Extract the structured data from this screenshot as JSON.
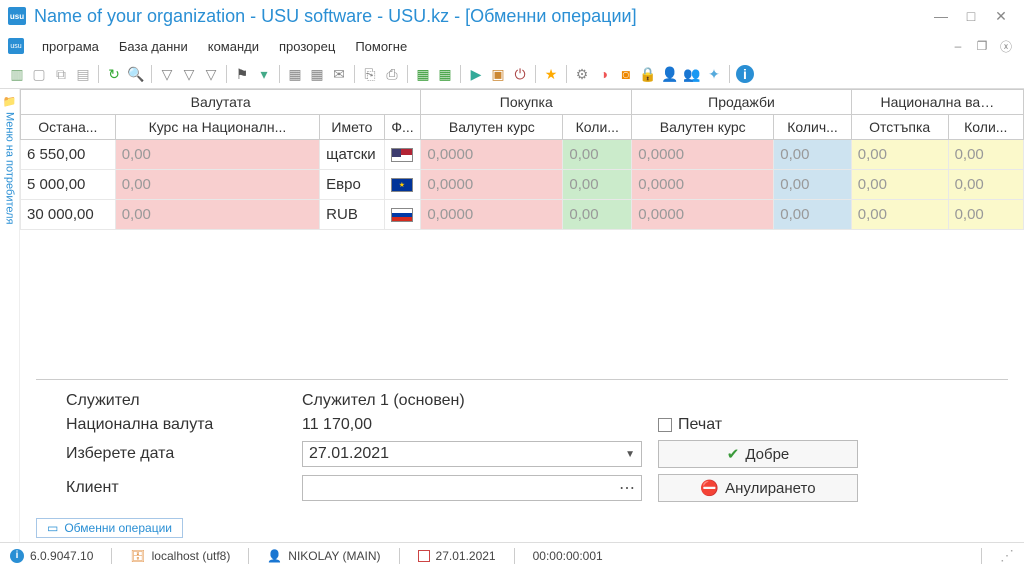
{
  "window": {
    "title": "Name of your organization - USU software - USU.kz - [Обменни операции]",
    "app_icon": "usu"
  },
  "menu": {
    "items": [
      "програма",
      "База данни",
      "команди",
      "прозорец",
      "Помогне"
    ]
  },
  "sidetab": {
    "label": "Меню на потребителя"
  },
  "grid": {
    "groups": [
      "Валутата",
      "Покупка",
      "Продажби",
      "Национална ва…"
    ],
    "cols": [
      "Остана...",
      "Курс на Националн...",
      "Името",
      "Ф...",
      "Валутен курс",
      "Коли...",
      "Валутен курс",
      "Колич...",
      "Отстъпка",
      "Коли..."
    ],
    "rows": [
      {
        "rest": "6 550,00",
        "nat": "0,00",
        "name": "щатски",
        "flag": "us",
        "buy_rate": "0,0000",
        "buy_qty": "0,00",
        "sell_rate": "0,0000",
        "sell_qty": "0,00",
        "disc": "0,00",
        "qty2": "0,00"
      },
      {
        "rest": "5 000,00",
        "nat": "0,00",
        "name": "Евро",
        "flag": "eu",
        "buy_rate": "0,0000",
        "buy_qty": "0,00",
        "sell_rate": "0,0000",
        "sell_qty": "0,00",
        "disc": "0,00",
        "qty2": "0,00"
      },
      {
        "rest": "30 000,00",
        "nat": "0,00",
        "name": "RUB",
        "flag": "ru",
        "buy_rate": "0,0000",
        "buy_qty": "0,00",
        "sell_rate": "0,0000",
        "sell_qty": "0,00",
        "disc": "0,00",
        "qty2": "0,00"
      }
    ]
  },
  "form": {
    "employee_label": "Служител",
    "employee_value": "Служител 1 (основен)",
    "natcur_label": "Национална валута",
    "natcur_value": "11 170,00",
    "print_label": "Печат",
    "date_label": "Изберете дата",
    "date_value": "27.01.2021",
    "ok_label": "Добре",
    "client_label": "Клиент",
    "cancel_label": "Анулирането"
  },
  "doctab": {
    "label": "Обменни операции"
  },
  "status": {
    "version": "6.0.9047.10",
    "host": "localhost (utf8)",
    "user": "NIKOLAY (MAIN)",
    "date": "27.01.2021",
    "time": "00:00:00:001"
  }
}
